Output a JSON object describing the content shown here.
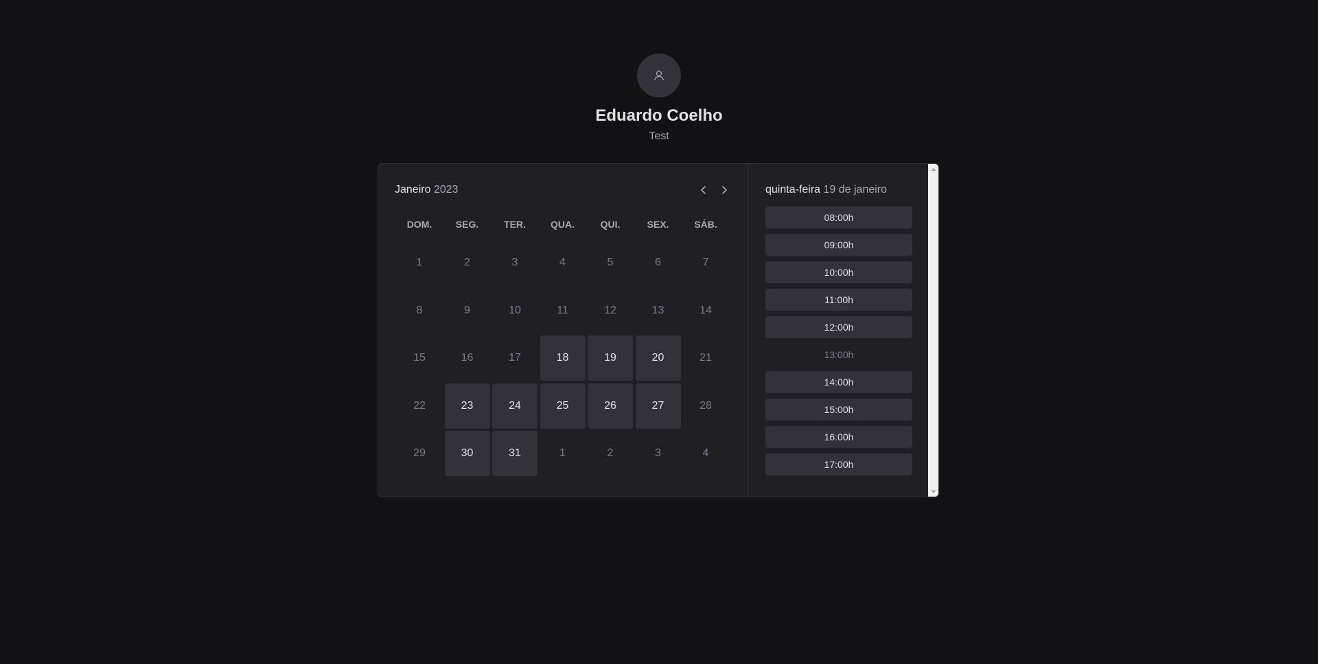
{
  "profile": {
    "avatar_icon": "user-icon",
    "name": "Eduardo Coelho",
    "bio": "Test"
  },
  "calendar": {
    "month": "Janeiro",
    "year": "2023",
    "prev_icon": "chevron-left-icon",
    "next_icon": "chevron-right-icon",
    "weekdays": [
      "DOM.",
      "SEG.",
      "TER.",
      "QUA.",
      "QUI.",
      "SEX.",
      "SÁB."
    ],
    "days": [
      {
        "label": "1",
        "available": false
      },
      {
        "label": "2",
        "available": false
      },
      {
        "label": "3",
        "available": false
      },
      {
        "label": "4",
        "available": false
      },
      {
        "label": "5",
        "available": false
      },
      {
        "label": "6",
        "available": false
      },
      {
        "label": "7",
        "available": false
      },
      {
        "label": "8",
        "available": false
      },
      {
        "label": "9",
        "available": false
      },
      {
        "label": "10",
        "available": false
      },
      {
        "label": "11",
        "available": false
      },
      {
        "label": "12",
        "available": false
      },
      {
        "label": "13",
        "available": false
      },
      {
        "label": "14",
        "available": false
      },
      {
        "label": "15",
        "available": false
      },
      {
        "label": "16",
        "available": false
      },
      {
        "label": "17",
        "available": false
      },
      {
        "label": "18",
        "available": true
      },
      {
        "label": "19",
        "available": true
      },
      {
        "label": "20",
        "available": true
      },
      {
        "label": "21",
        "available": false
      },
      {
        "label": "22",
        "available": false
      },
      {
        "label": "23",
        "available": true
      },
      {
        "label": "24",
        "available": true
      },
      {
        "label": "25",
        "available": true
      },
      {
        "label": "26",
        "available": true
      },
      {
        "label": "27",
        "available": true
      },
      {
        "label": "28",
        "available": false
      },
      {
        "label": "29",
        "available": false
      },
      {
        "label": "30",
        "available": true
      },
      {
        "label": "31",
        "available": true
      },
      {
        "label": "1",
        "available": false
      },
      {
        "label": "2",
        "available": false
      },
      {
        "label": "3",
        "available": false
      },
      {
        "label": "4",
        "available": false
      }
    ]
  },
  "time_picker": {
    "weekday": "quinta-feira",
    "date": "19 de janeiro",
    "slots": [
      {
        "label": "08:00h",
        "available": true
      },
      {
        "label": "09:00h",
        "available": true
      },
      {
        "label": "10:00h",
        "available": true
      },
      {
        "label": "11:00h",
        "available": true
      },
      {
        "label": "12:00h",
        "available": true
      },
      {
        "label": "13:00h",
        "available": false
      },
      {
        "label": "14:00h",
        "available": true
      },
      {
        "label": "15:00h",
        "available": true
      },
      {
        "label": "16:00h",
        "available": true
      },
      {
        "label": "17:00h",
        "available": true
      }
    ]
  }
}
